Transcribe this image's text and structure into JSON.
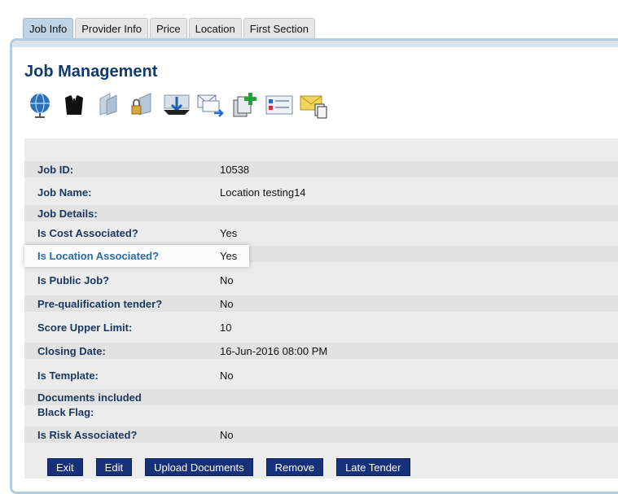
{
  "tabs": [
    {
      "label": "Job Info"
    },
    {
      "label": "Provider Info"
    },
    {
      "label": "Price"
    },
    {
      "label": "Location"
    },
    {
      "label": "First Section"
    }
  ],
  "page_title": "Job Management",
  "toolbar_icons": [
    "globe-icon",
    "person-icon",
    "folder-icon",
    "lock-folder-icon",
    "download-tray-icon",
    "forward-mail-icon",
    "add-copy-icon",
    "list-card-icon",
    "mail-copy-icon"
  ],
  "fields": [
    {
      "label": "Job ID:",
      "value": "10538"
    },
    {
      "label": "Job Name:",
      "value": "Location testing14"
    },
    {
      "label": "Job Details:",
      "value": ""
    },
    {
      "label": "Is Cost Associated?",
      "value": "Yes"
    },
    {
      "label": "Is Location Associated?",
      "value": "Yes"
    },
    {
      "label": "Is Public Job?",
      "value": "No"
    },
    {
      "label": "Pre-qualification tender?",
      "value": "No"
    },
    {
      "label": "Score Upper Limit:",
      "value": "10"
    },
    {
      "label": "Closing Date:",
      "value": "16-Jun-2016 08:00 PM"
    },
    {
      "label": "Is Template:",
      "value": "No"
    },
    {
      "label": "Documents included",
      "value": ""
    },
    {
      "label": "Black Flag:",
      "value": ""
    },
    {
      "label": "Is Risk Associated?",
      "value": "No"
    }
  ],
  "buttons": [
    {
      "label": "Exit"
    },
    {
      "label": "Edit"
    },
    {
      "label": "Upload Documents"
    },
    {
      "label": "Remove"
    },
    {
      "label": "Late Tender"
    }
  ],
  "colors": {
    "accent": "#16307a",
    "label": "#17375e",
    "highlight_label": "#2d6aa6",
    "tab_active": "#bcd4e6"
  }
}
